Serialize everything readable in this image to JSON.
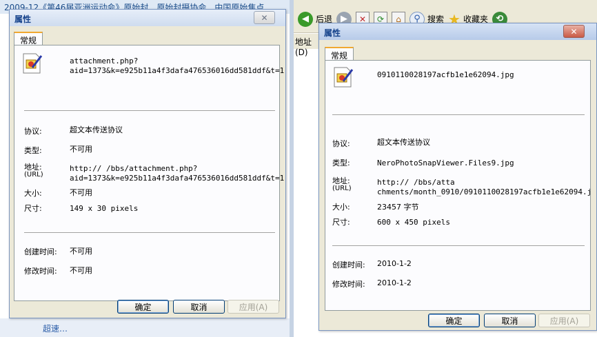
{
  "background_left": {
    "title_fragment": "2009-12《第46届亚洲运动会》原始封…原始封摄协会…中国原始焦点",
    "bottom_fragment": "超速…"
  },
  "background_right": {
    "back_label": "后退",
    "search_label": "搜索",
    "favorites_label": "收藏夹",
    "address_label": "地址(D)"
  },
  "dialog_left": {
    "title": "属性",
    "close": "✕",
    "tab": "常规",
    "filename_line1": "attachment.php?",
    "filename_line2": "aid=1373&k=e925b11a4f3dafa476536016dd581ddf&t=1",
    "protocol_label": "协议:",
    "protocol_value": "超文本传送协议",
    "type_label": "类型:",
    "type_value": "不可用",
    "address_label": "地址:",
    "address_label_sub": "(URL)",
    "address_line1": "http://            /bbs/attachment.php?",
    "address_line2": "aid=1373&k=e925b11a4f3dafa476536016dd581ddf&t=1",
    "size_label": "大小:",
    "size_value": "不可用",
    "dimensions_label": "尺寸:",
    "dimensions_value": "149  x  30  pixels",
    "created_label": "创建时间:",
    "created_value": "不可用",
    "modified_label": "修改时间:",
    "modified_value": "不可用",
    "ok": "确定",
    "cancel": "取消",
    "apply": "应用(A)"
  },
  "dialog_right": {
    "title": "属性",
    "close": "✕",
    "tab": "常规",
    "filename": "0910110028197acfb1e1e62094.jpg",
    "protocol_label": "协议:",
    "protocol_value": "超文本传送协议",
    "type_label": "类型:",
    "type_value": "NeroPhotoSnapViewer.Files9.jpg",
    "address_label": "地址:",
    "address_label_sub": "(URL)",
    "address_line1": "http://                              /bbs/atta",
    "address_line2": "chments/month_0910/0910110028197acfb1e1e62094.j",
    "size_label": "大小:",
    "size_value": "23457 字节",
    "dimensions_label": "尺寸:",
    "dimensions_value": "600  x  450  pixels",
    "created_label": "创建时间:",
    "created_value": "2010-1-2",
    "modified_label": "修改时间:",
    "modified_value": "2010-1-2",
    "ok": "确定",
    "cancel": "取消",
    "apply": "应用(A)"
  }
}
